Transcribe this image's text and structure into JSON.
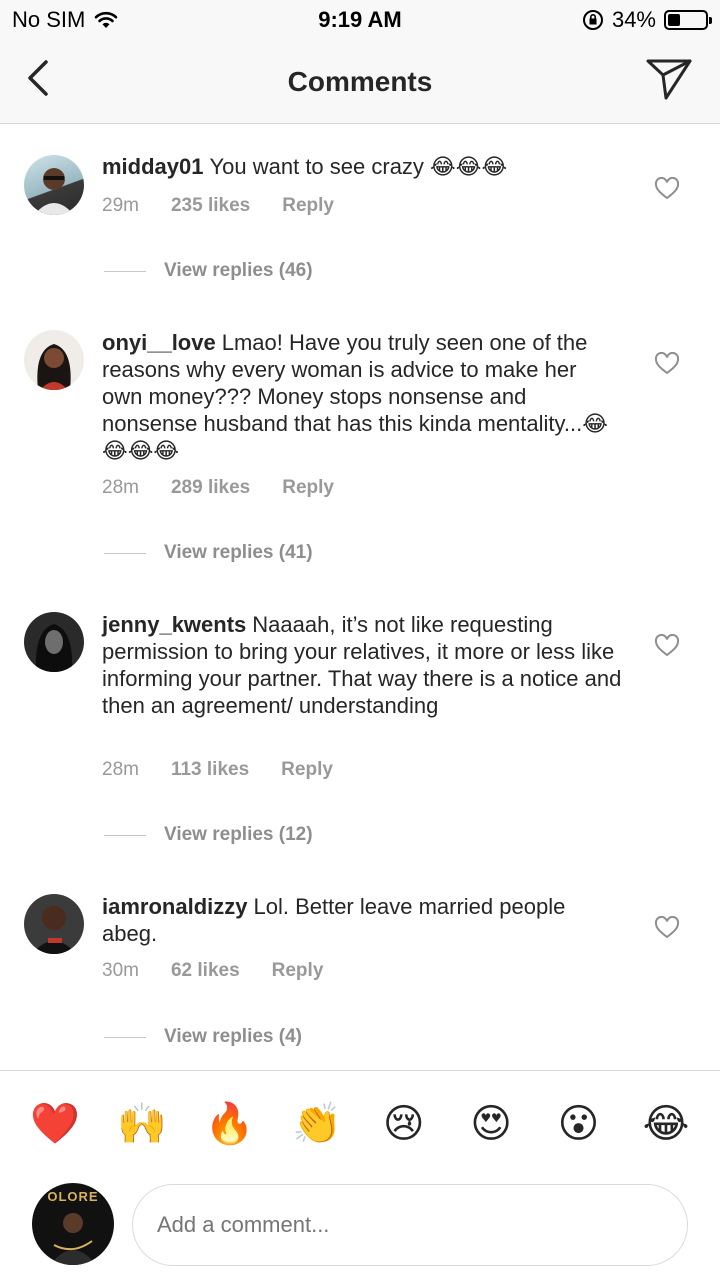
{
  "status_bar": {
    "carrier": "No SIM",
    "time": "9:19 AM",
    "battery": "34%",
    "battery_level": 0.34
  },
  "nav": {
    "title": "Comments"
  },
  "comments": [
    {
      "username": "midday01",
      "text": "You want to see crazy 😂😂😂",
      "time": "29m",
      "likes": "235 likes",
      "reply": "Reply",
      "view_replies": "View replies (46)"
    },
    {
      "username": "onyi__love",
      "text": "Lmao! Have you truly seen one of the reasons why every woman is advice to make her own money??? Money stops nonsense and nonsense husband that has this kinda mentality...😂😂😂😂",
      "time": "28m",
      "likes": "289 likes",
      "reply": "Reply",
      "view_replies": "View replies (41)"
    },
    {
      "username": "jenny_kwents",
      "text": "Naaaah, it’s not like requesting permission to bring your relatives, it more or less like informing your partner. That way there is a notice and then an agreement/ understanding",
      "time": "28m",
      "likes": "113 likes",
      "reply": "Reply",
      "view_replies": "View replies (12)"
    },
    {
      "username": "iamronaldizzy",
      "text": "Lol. Better leave married people abeg.",
      "time": "30m",
      "likes": "62 likes",
      "reply": "Reply",
      "view_replies": "View replies (4)"
    }
  ],
  "quick_reactions": [
    "❤️",
    "🙌",
    "🔥",
    "👏",
    "😢",
    "😍",
    "😮",
    "😂"
  ],
  "composer": {
    "placeholder": "Add a comment...",
    "avatar_text": "OLORE"
  }
}
